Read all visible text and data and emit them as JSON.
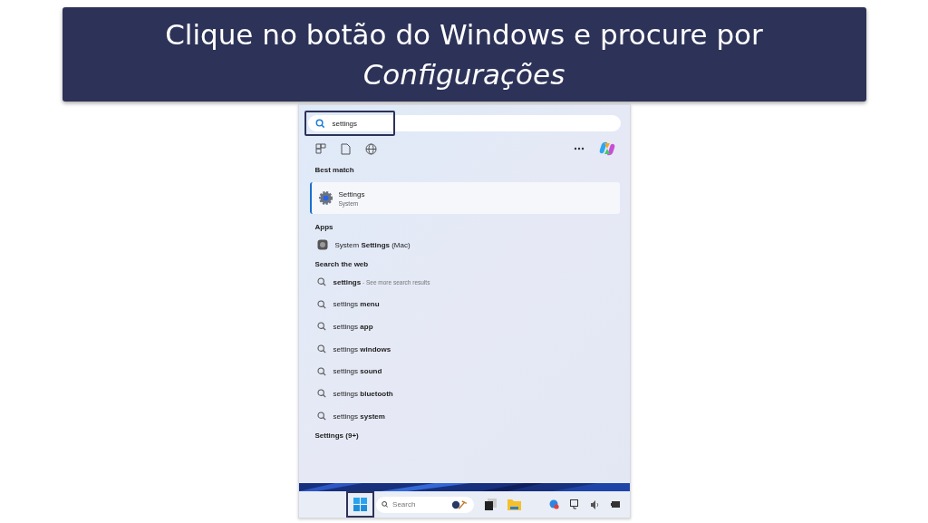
{
  "banner": {
    "title": "Clique no botão do Windows e procure por *Configurações*"
  },
  "search": {
    "value": "settings",
    "highlighted": true
  },
  "best_match": {
    "heading": "Best match",
    "name": "Settings",
    "subtitle": "System",
    "selected": true
  },
  "apps": {
    "heading": "Apps",
    "items": [
      {
        "label": "System **Settings** (Mac)"
      }
    ]
  },
  "web": {
    "heading": "Search the web",
    "items": [
      {
        "label": "**settings**",
        "hint": " - See more search results"
      },
      {
        "label": "settings **menu**"
      },
      {
        "label": "settings **app**"
      },
      {
        "label": "settings **windows**"
      },
      {
        "label": "settings **sound**"
      },
      {
        "label": "settings **bluetooth**"
      },
      {
        "label": "settings **system**"
      }
    ]
  },
  "settings_section": {
    "heading": "Settings (9+)"
  },
  "taskbar": {
    "start_highlighted": true,
    "search_placeholder": "Search"
  }
}
